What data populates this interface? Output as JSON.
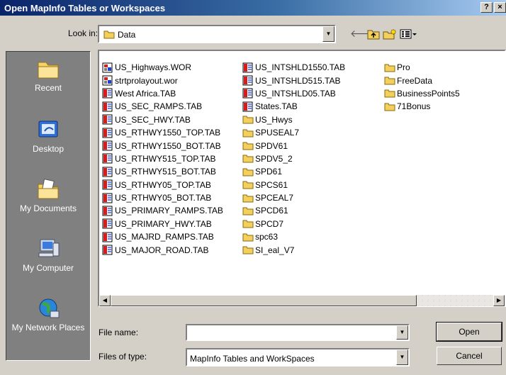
{
  "window": {
    "title": "Open MapInfo Tables or Workspaces",
    "help_glyph": "?",
    "close_glyph": "×"
  },
  "lookin": {
    "label": "Look in:",
    "value": "Data"
  },
  "places": [
    {
      "label": "Recent",
      "icon": "recent-folder-icon"
    },
    {
      "label": "Desktop",
      "icon": "desktop-icon"
    },
    {
      "label": "My Documents",
      "icon": "my-documents-icon"
    },
    {
      "label": "My Computer",
      "icon": "my-computer-icon"
    },
    {
      "label": "My Network Places",
      "icon": "network-globe-icon"
    }
  ],
  "files": {
    "col1": [
      {
        "name": "US_Highways.WOR",
        "kind": "workspace"
      },
      {
        "name": "strtprolayout.wor",
        "kind": "workspace"
      },
      {
        "name": "West Africa.TAB",
        "kind": "table"
      },
      {
        "name": "US_SEC_RAMPS.TAB",
        "kind": "table"
      },
      {
        "name": "US_SEC_HWY.TAB",
        "kind": "table"
      },
      {
        "name": "US_RTHWY1550_TOP.TAB",
        "kind": "table"
      },
      {
        "name": "US_RTHWY1550_BOT.TAB",
        "kind": "table"
      },
      {
        "name": "US_RTHWY515_TOP.TAB",
        "kind": "table"
      },
      {
        "name": "US_RTHWY515_BOT.TAB",
        "kind": "table"
      },
      {
        "name": "US_RTHWY05_TOP.TAB",
        "kind": "table"
      },
      {
        "name": "US_RTHWY05_BOT.TAB",
        "kind": "table"
      },
      {
        "name": "US_PRIMARY_RAMPS.TAB",
        "kind": "table"
      },
      {
        "name": "US_PRIMARY_HWY.TAB",
        "kind": "table"
      },
      {
        "name": "US_MAJRD_RAMPS.TAB",
        "kind": "table"
      },
      {
        "name": "US_MAJOR_ROAD.TAB",
        "kind": "table"
      }
    ],
    "col2": [
      {
        "name": "US_INTSHLD1550.TAB",
        "kind": "table"
      },
      {
        "name": "US_INTSHLD515.TAB",
        "kind": "table"
      },
      {
        "name": "US_INTSHLD05.TAB",
        "kind": "table"
      },
      {
        "name": "States.TAB",
        "kind": "table"
      },
      {
        "name": "US_Hwys",
        "kind": "folder"
      },
      {
        "name": "SPUSEAL7",
        "kind": "folder"
      },
      {
        "name": "SPDV61",
        "kind": "folder"
      },
      {
        "name": "SPDV5_2",
        "kind": "folder"
      },
      {
        "name": "SPD61",
        "kind": "folder"
      },
      {
        "name": "SPCS61",
        "kind": "folder"
      },
      {
        "name": "SPCEAL7",
        "kind": "folder"
      },
      {
        "name": "SPCD61",
        "kind": "folder"
      },
      {
        "name": "SPCD7",
        "kind": "folder"
      },
      {
        "name": "spc63",
        "kind": "folder"
      },
      {
        "name": "SI_eal_V7",
        "kind": "folder"
      }
    ],
    "col3": [
      {
        "name": "Pro",
        "kind": "folder"
      },
      {
        "name": "FreeData",
        "kind": "folder"
      },
      {
        "name": "BusinessPoints5",
        "kind": "folder"
      },
      {
        "name": "71Bonus",
        "kind": "folder"
      }
    ]
  },
  "filename": {
    "label": "File name:",
    "value": ""
  },
  "filetype": {
    "label": "Files of type:",
    "value": "MapInfo Tables and WorkSpaces"
  },
  "buttons": {
    "open": "Open",
    "cancel": "Cancel"
  },
  "colors": {
    "title_start": "#0a246a",
    "title_end": "#a6caf0",
    "places_bg": "#808080",
    "folder": "#f3cf5b",
    "table_accent": "#d81b1b"
  }
}
